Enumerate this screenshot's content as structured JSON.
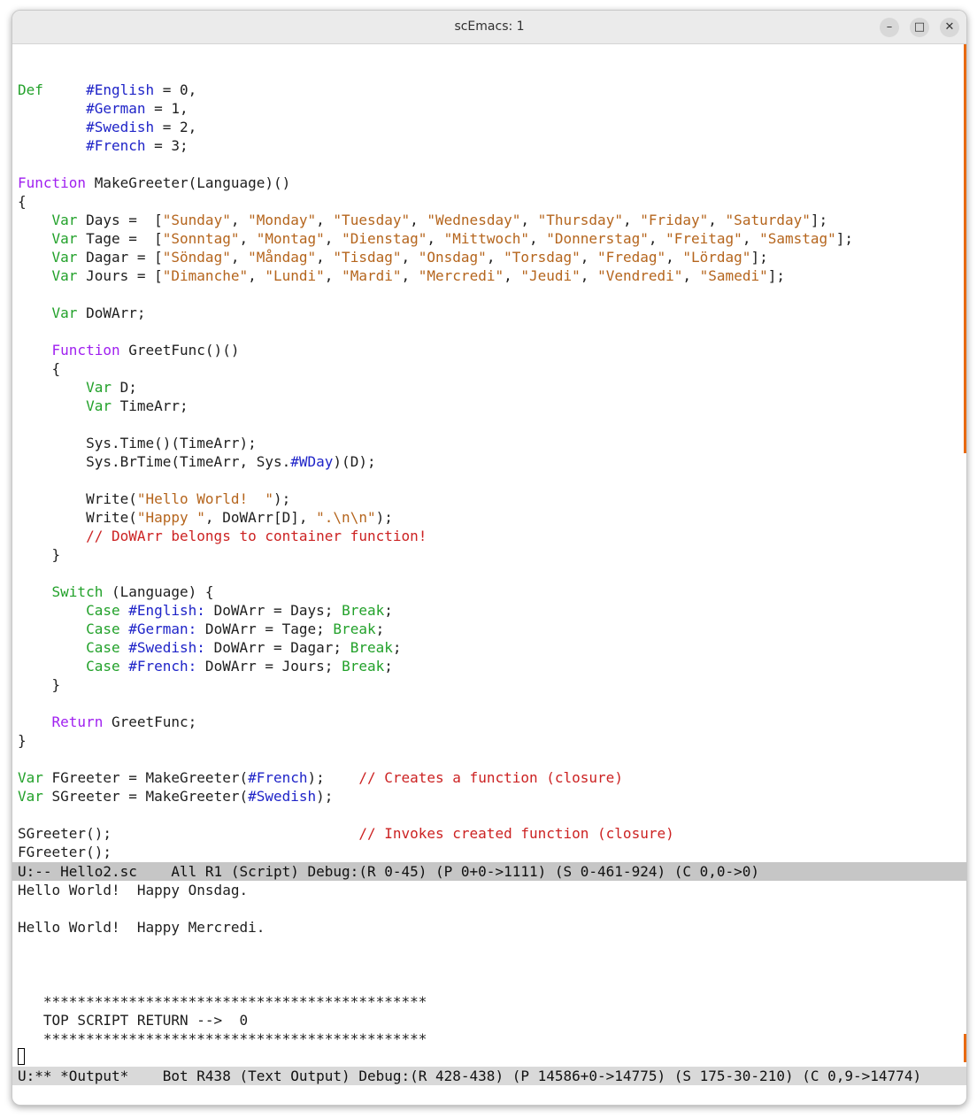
{
  "window": {
    "title": "scEmacs: 1",
    "minimize_glyph": "–",
    "maximize_glyph": "□",
    "close_glyph": "✕"
  },
  "colors": {
    "keyword_green": "#22a12a",
    "keyword_purple": "#a020f0",
    "symbol_blue": "#1f24c8",
    "string_orange": "#b5651d",
    "comment_red": "#cc2222",
    "scrollbar": "#e86a12",
    "modeline_bg": "#c6c6c6"
  },
  "code_lines": [
    [],
    [
      {
        "t": "Def",
        "c": "kw-green"
      },
      {
        "t": "     "
      },
      {
        "t": "#English",
        "c": "sym"
      },
      {
        "t": " = 0,"
      }
    ],
    [
      {
        "t": "        "
      },
      {
        "t": "#German",
        "c": "sym"
      },
      {
        "t": " = 1,"
      }
    ],
    [
      {
        "t": "        "
      },
      {
        "t": "#Swedish",
        "c": "sym"
      },
      {
        "t": " = 2,"
      }
    ],
    [
      {
        "t": "        "
      },
      {
        "t": "#French",
        "c": "sym"
      },
      {
        "t": " = 3;"
      }
    ],
    [],
    [
      {
        "t": "Function",
        "c": "kw-purple"
      },
      {
        "t": " MakeGreeter(Language)()"
      }
    ],
    [
      {
        "t": "{"
      }
    ],
    [
      {
        "t": "    "
      },
      {
        "t": "Var",
        "c": "kw-green"
      },
      {
        "t": " Days =  ["
      },
      {
        "t": "\"Sunday\"",
        "c": "str"
      },
      {
        "t": ", "
      },
      {
        "t": "\"Monday\"",
        "c": "str"
      },
      {
        "t": ", "
      },
      {
        "t": "\"Tuesday\"",
        "c": "str"
      },
      {
        "t": ", "
      },
      {
        "t": "\"Wednesday\"",
        "c": "str"
      },
      {
        "t": ", "
      },
      {
        "t": "\"Thursday\"",
        "c": "str"
      },
      {
        "t": ", "
      },
      {
        "t": "\"Friday\"",
        "c": "str"
      },
      {
        "t": ", "
      },
      {
        "t": "\"Saturday\"",
        "c": "str"
      },
      {
        "t": "];"
      }
    ],
    [
      {
        "t": "    "
      },
      {
        "t": "Var",
        "c": "kw-green"
      },
      {
        "t": " Tage =  ["
      },
      {
        "t": "\"Sonntag\"",
        "c": "str"
      },
      {
        "t": ", "
      },
      {
        "t": "\"Montag\"",
        "c": "str"
      },
      {
        "t": ", "
      },
      {
        "t": "\"Dienstag\"",
        "c": "str"
      },
      {
        "t": ", "
      },
      {
        "t": "\"Mittwoch\"",
        "c": "str"
      },
      {
        "t": ", "
      },
      {
        "t": "\"Donnerstag\"",
        "c": "str"
      },
      {
        "t": ", "
      },
      {
        "t": "\"Freitag\"",
        "c": "str"
      },
      {
        "t": ", "
      },
      {
        "t": "\"Samstag\"",
        "c": "str"
      },
      {
        "t": "];"
      }
    ],
    [
      {
        "t": "    "
      },
      {
        "t": "Var",
        "c": "kw-green"
      },
      {
        "t": " Dagar = ["
      },
      {
        "t": "\"Söndag\"",
        "c": "str"
      },
      {
        "t": ", "
      },
      {
        "t": "\"Måndag\"",
        "c": "str"
      },
      {
        "t": ", "
      },
      {
        "t": "\"Tisdag\"",
        "c": "str"
      },
      {
        "t": ", "
      },
      {
        "t": "\"Onsdag\"",
        "c": "str"
      },
      {
        "t": ", "
      },
      {
        "t": "\"Torsdag\"",
        "c": "str"
      },
      {
        "t": ", "
      },
      {
        "t": "\"Fredag\"",
        "c": "str"
      },
      {
        "t": ", "
      },
      {
        "t": "\"Lördag\"",
        "c": "str"
      },
      {
        "t": "];"
      }
    ],
    [
      {
        "t": "    "
      },
      {
        "t": "Var",
        "c": "kw-green"
      },
      {
        "t": " Jours = ["
      },
      {
        "t": "\"Dimanche\"",
        "c": "str"
      },
      {
        "t": ", "
      },
      {
        "t": "\"Lundi\"",
        "c": "str"
      },
      {
        "t": ", "
      },
      {
        "t": "\"Mardi\"",
        "c": "str"
      },
      {
        "t": ", "
      },
      {
        "t": "\"Mercredi\"",
        "c": "str"
      },
      {
        "t": ", "
      },
      {
        "t": "\"Jeudi\"",
        "c": "str"
      },
      {
        "t": ", "
      },
      {
        "t": "\"Vendredi\"",
        "c": "str"
      },
      {
        "t": ", "
      },
      {
        "t": "\"Samedi\"",
        "c": "str"
      },
      {
        "t": "];"
      }
    ],
    [],
    [
      {
        "t": "    "
      },
      {
        "t": "Var",
        "c": "kw-green"
      },
      {
        "t": " DoWArr;"
      }
    ],
    [],
    [
      {
        "t": "    "
      },
      {
        "t": "Function",
        "c": "kw-purple"
      },
      {
        "t": " GreetFunc()()"
      }
    ],
    [
      {
        "t": "    {"
      }
    ],
    [
      {
        "t": "        "
      },
      {
        "t": "Var",
        "c": "kw-green"
      },
      {
        "t": " D;"
      }
    ],
    [
      {
        "t": "        "
      },
      {
        "t": "Var",
        "c": "kw-green"
      },
      {
        "t": " TimeArr;"
      }
    ],
    [],
    [
      {
        "t": "        Sys.Time()(TimeArr);"
      }
    ],
    [
      {
        "t": "        Sys.BrTime(TimeArr, Sys."
      },
      {
        "t": "#WDay",
        "c": "sym"
      },
      {
        "t": ")(D);"
      }
    ],
    [],
    [
      {
        "t": "        Write("
      },
      {
        "t": "\"Hello World!  \"",
        "c": "str"
      },
      {
        "t": ");"
      }
    ],
    [
      {
        "t": "        Write("
      },
      {
        "t": "\"Happy \"",
        "c": "str"
      },
      {
        "t": ", DoWArr[D], "
      },
      {
        "t": "\".\\n\\n\"",
        "c": "str"
      },
      {
        "t": ");"
      }
    ],
    [
      {
        "t": "        "
      },
      {
        "t": "// DoWArr belongs to container function!",
        "c": "cmt"
      }
    ],
    [
      {
        "t": "    }"
      }
    ],
    [],
    [
      {
        "t": "    "
      },
      {
        "t": "Switch",
        "c": "kw-green"
      },
      {
        "t": " (Language) {"
      }
    ],
    [
      {
        "t": "        "
      },
      {
        "t": "Case",
        "c": "kw-green"
      },
      {
        "t": " "
      },
      {
        "t": "#English:",
        "c": "sym"
      },
      {
        "t": " DoWArr = Days; "
      },
      {
        "t": "Break",
        "c": "kw-green"
      },
      {
        "t": ";"
      }
    ],
    [
      {
        "t": "        "
      },
      {
        "t": "Case",
        "c": "kw-green"
      },
      {
        "t": " "
      },
      {
        "t": "#German:",
        "c": "sym"
      },
      {
        "t": " DoWArr = Tage; "
      },
      {
        "t": "Break",
        "c": "kw-green"
      },
      {
        "t": ";"
      }
    ],
    [
      {
        "t": "        "
      },
      {
        "t": "Case",
        "c": "kw-green"
      },
      {
        "t": " "
      },
      {
        "t": "#Swedish:",
        "c": "sym"
      },
      {
        "t": " DoWArr = Dagar; "
      },
      {
        "t": "Break",
        "c": "kw-green"
      },
      {
        "t": ";"
      }
    ],
    [
      {
        "t": "        "
      },
      {
        "t": "Case",
        "c": "kw-green"
      },
      {
        "t": " "
      },
      {
        "t": "#French:",
        "c": "sym"
      },
      {
        "t": " DoWArr = Jours; "
      },
      {
        "t": "Break",
        "c": "kw-green"
      },
      {
        "t": ";"
      }
    ],
    [
      {
        "t": "    }"
      }
    ],
    [],
    [
      {
        "t": "    "
      },
      {
        "t": "Return",
        "c": "kw-purple"
      },
      {
        "t": " GreetFunc;"
      }
    ],
    [
      {
        "t": "}"
      }
    ],
    [],
    [
      {
        "t": "Var",
        "c": "kw-green"
      },
      {
        "t": " FGreeter = MakeGreeter("
      },
      {
        "t": "#French",
        "c": "sym"
      },
      {
        "t": ");    "
      },
      {
        "t": "// Creates a function (closure)",
        "c": "cmt"
      }
    ],
    [
      {
        "t": "Var",
        "c": "kw-green"
      },
      {
        "t": " SGreeter = MakeGreeter("
      },
      {
        "t": "#Swedish",
        "c": "sym"
      },
      {
        "t": ");"
      }
    ],
    [],
    [
      {
        "t": "SGreeter();                             "
      },
      {
        "t": "// Invokes created function (closure)",
        "c": "cmt"
      }
    ],
    [
      {
        "t": "FGreeter();"
      }
    ]
  ],
  "modeline_top": "U:-- Hello2.sc    All R1 (Script) Debug:(R 0-45) (P 0+0->1111) (S 0-461-924) (C 0,0->0)",
  "output_lines": [
    "Hello World!  Happy Onsdag.",
    "",
    "Hello World!  Happy Mercredi.",
    "",
    "",
    "",
    "   *********************************************",
    "   TOP SCRIPT RETURN -->  0",
    "   *********************************************"
  ],
  "modeline_bottom": "U:** *Output*    Bot R438 (Text Output) Debug:(R 428-438) (P 14586+0->14775) (S 175-30-210) (C 0,9->14774)"
}
